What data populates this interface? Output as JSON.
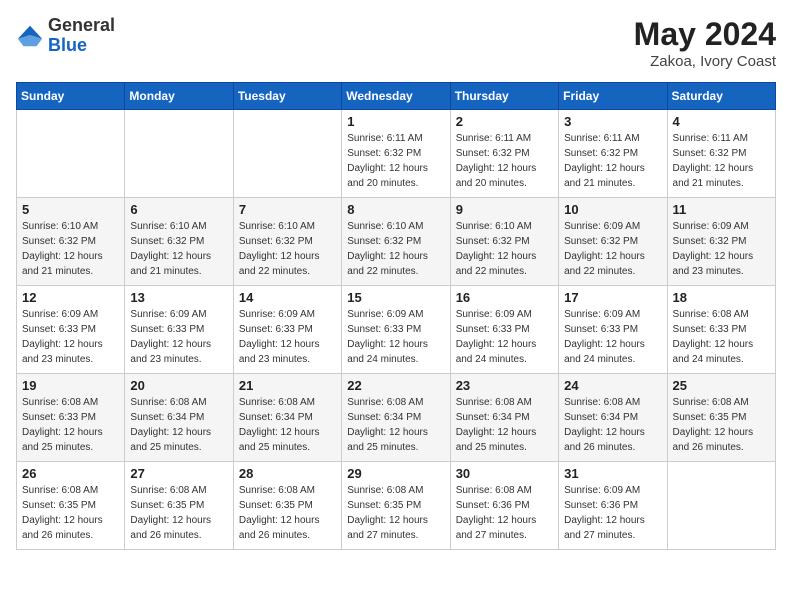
{
  "header": {
    "logo": {
      "general": "General",
      "blue": "Blue"
    },
    "title": "May 2024",
    "location": "Zakoa, Ivory Coast"
  },
  "calendar": {
    "weekdays": [
      "Sunday",
      "Monday",
      "Tuesday",
      "Wednesday",
      "Thursday",
      "Friday",
      "Saturday"
    ],
    "weeks": [
      [
        {
          "day": "",
          "info": ""
        },
        {
          "day": "",
          "info": ""
        },
        {
          "day": "",
          "info": ""
        },
        {
          "day": "1",
          "info": "Sunrise: 6:11 AM\nSunset: 6:32 PM\nDaylight: 12 hours\nand 20 minutes."
        },
        {
          "day": "2",
          "info": "Sunrise: 6:11 AM\nSunset: 6:32 PM\nDaylight: 12 hours\nand 20 minutes."
        },
        {
          "day": "3",
          "info": "Sunrise: 6:11 AM\nSunset: 6:32 PM\nDaylight: 12 hours\nand 21 minutes."
        },
        {
          "day": "4",
          "info": "Sunrise: 6:11 AM\nSunset: 6:32 PM\nDaylight: 12 hours\nand 21 minutes."
        }
      ],
      [
        {
          "day": "5",
          "info": "Sunrise: 6:10 AM\nSunset: 6:32 PM\nDaylight: 12 hours\nand 21 minutes."
        },
        {
          "day": "6",
          "info": "Sunrise: 6:10 AM\nSunset: 6:32 PM\nDaylight: 12 hours\nand 21 minutes."
        },
        {
          "day": "7",
          "info": "Sunrise: 6:10 AM\nSunset: 6:32 PM\nDaylight: 12 hours\nand 22 minutes."
        },
        {
          "day": "8",
          "info": "Sunrise: 6:10 AM\nSunset: 6:32 PM\nDaylight: 12 hours\nand 22 minutes."
        },
        {
          "day": "9",
          "info": "Sunrise: 6:10 AM\nSunset: 6:32 PM\nDaylight: 12 hours\nand 22 minutes."
        },
        {
          "day": "10",
          "info": "Sunrise: 6:09 AM\nSunset: 6:32 PM\nDaylight: 12 hours\nand 22 minutes."
        },
        {
          "day": "11",
          "info": "Sunrise: 6:09 AM\nSunset: 6:32 PM\nDaylight: 12 hours\nand 23 minutes."
        }
      ],
      [
        {
          "day": "12",
          "info": "Sunrise: 6:09 AM\nSunset: 6:33 PM\nDaylight: 12 hours\nand 23 minutes."
        },
        {
          "day": "13",
          "info": "Sunrise: 6:09 AM\nSunset: 6:33 PM\nDaylight: 12 hours\nand 23 minutes."
        },
        {
          "day": "14",
          "info": "Sunrise: 6:09 AM\nSunset: 6:33 PM\nDaylight: 12 hours\nand 23 minutes."
        },
        {
          "day": "15",
          "info": "Sunrise: 6:09 AM\nSunset: 6:33 PM\nDaylight: 12 hours\nand 24 minutes."
        },
        {
          "day": "16",
          "info": "Sunrise: 6:09 AM\nSunset: 6:33 PM\nDaylight: 12 hours\nand 24 minutes."
        },
        {
          "day": "17",
          "info": "Sunrise: 6:09 AM\nSunset: 6:33 PM\nDaylight: 12 hours\nand 24 minutes."
        },
        {
          "day": "18",
          "info": "Sunrise: 6:08 AM\nSunset: 6:33 PM\nDaylight: 12 hours\nand 24 minutes."
        }
      ],
      [
        {
          "day": "19",
          "info": "Sunrise: 6:08 AM\nSunset: 6:33 PM\nDaylight: 12 hours\nand 25 minutes."
        },
        {
          "day": "20",
          "info": "Sunrise: 6:08 AM\nSunset: 6:34 PM\nDaylight: 12 hours\nand 25 minutes."
        },
        {
          "day": "21",
          "info": "Sunrise: 6:08 AM\nSunset: 6:34 PM\nDaylight: 12 hours\nand 25 minutes."
        },
        {
          "day": "22",
          "info": "Sunrise: 6:08 AM\nSunset: 6:34 PM\nDaylight: 12 hours\nand 25 minutes."
        },
        {
          "day": "23",
          "info": "Sunrise: 6:08 AM\nSunset: 6:34 PM\nDaylight: 12 hours\nand 25 minutes."
        },
        {
          "day": "24",
          "info": "Sunrise: 6:08 AM\nSunset: 6:34 PM\nDaylight: 12 hours\nand 26 minutes."
        },
        {
          "day": "25",
          "info": "Sunrise: 6:08 AM\nSunset: 6:35 PM\nDaylight: 12 hours\nand 26 minutes."
        }
      ],
      [
        {
          "day": "26",
          "info": "Sunrise: 6:08 AM\nSunset: 6:35 PM\nDaylight: 12 hours\nand 26 minutes."
        },
        {
          "day": "27",
          "info": "Sunrise: 6:08 AM\nSunset: 6:35 PM\nDaylight: 12 hours\nand 26 minutes."
        },
        {
          "day": "28",
          "info": "Sunrise: 6:08 AM\nSunset: 6:35 PM\nDaylight: 12 hours\nand 26 minutes."
        },
        {
          "day": "29",
          "info": "Sunrise: 6:08 AM\nSunset: 6:35 PM\nDaylight: 12 hours\nand 27 minutes."
        },
        {
          "day": "30",
          "info": "Sunrise: 6:08 AM\nSunset: 6:36 PM\nDaylight: 12 hours\nand 27 minutes."
        },
        {
          "day": "31",
          "info": "Sunrise: 6:09 AM\nSunset: 6:36 PM\nDaylight: 12 hours\nand 27 minutes."
        },
        {
          "day": "",
          "info": ""
        }
      ]
    ]
  }
}
